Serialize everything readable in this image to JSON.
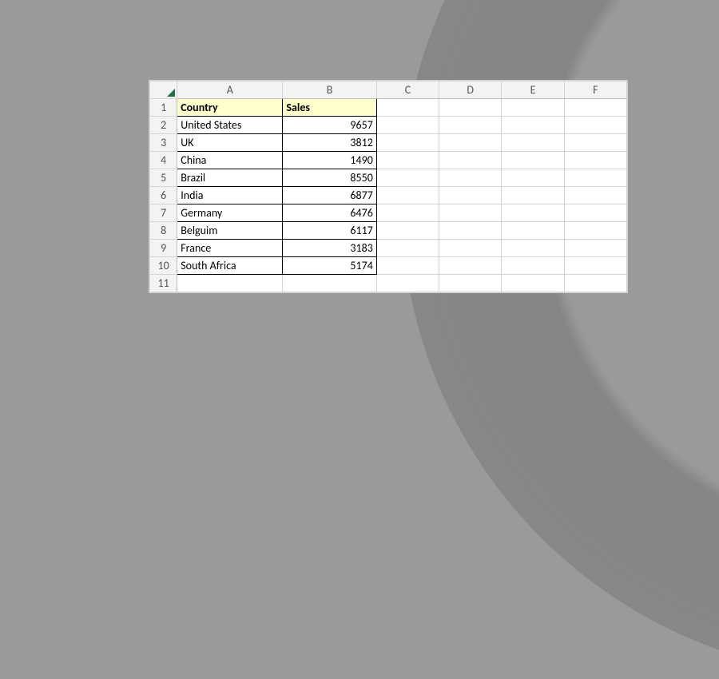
{
  "columns": [
    "A",
    "B",
    "C",
    "D",
    "E",
    "F"
  ],
  "header": {
    "A": "Country",
    "B": "Sales"
  },
  "rows": [
    {
      "n": 1,
      "A": "Country",
      "B": "Sales",
      "hdr": true
    },
    {
      "n": 2,
      "A": "United States",
      "B": "9657"
    },
    {
      "n": 3,
      "A": "UK",
      "B": "3812"
    },
    {
      "n": 4,
      "A": "China",
      "B": "1490"
    },
    {
      "n": 5,
      "A": "Brazil",
      "B": "8550"
    },
    {
      "n": 6,
      "A": "India",
      "B": "6877"
    },
    {
      "n": 7,
      "A": "Germany",
      "B": "6476"
    },
    {
      "n": 8,
      "A": "Belguim",
      "B": "6117"
    },
    {
      "n": 9,
      "A": "France",
      "B": "3183"
    },
    {
      "n": 10,
      "A": "South Africa",
      "B": "5174"
    },
    {
      "n": 11,
      "A": "",
      "B": ""
    }
  ],
  "chart_data": {
    "type": "table",
    "title": "",
    "columns": [
      "Country",
      "Sales"
    ],
    "data": [
      [
        "United States",
        9657
      ],
      [
        "UK",
        3812
      ],
      [
        "China",
        1490
      ],
      [
        "Brazil",
        8550
      ],
      [
        "India",
        6877
      ],
      [
        "Germany",
        6476
      ],
      [
        "Belguim",
        6117
      ],
      [
        "France",
        3183
      ],
      [
        "South Africa",
        5174
      ]
    ]
  }
}
